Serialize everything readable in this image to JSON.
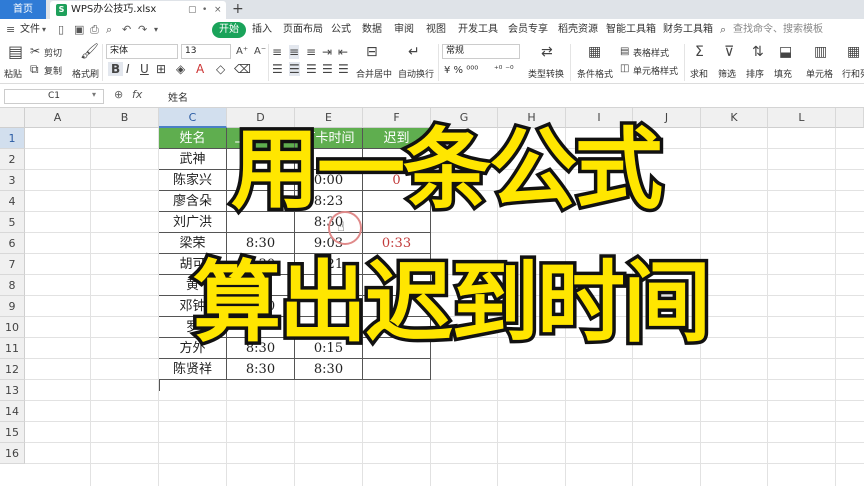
{
  "titlebar": {
    "home_tab": "首页",
    "file_name": "WPS办公技巧.xlsx",
    "file_icon": "S",
    "new_tab": "+",
    "tab_controls": [
      "▢",
      "•",
      "×"
    ]
  },
  "menubar": {
    "file_menu": "文件",
    "items": [
      "开始",
      "插入",
      "页面布局",
      "公式",
      "数据",
      "审阅",
      "视图",
      "开发工具",
      "会员专享",
      "稻壳资源",
      "智能工具箱",
      "财务工具箱"
    ],
    "search_placeholder": "查找命令、搜索模板"
  },
  "ribbon": {
    "paste": "粘贴",
    "cut": "剪切",
    "copy": "复制",
    "format_painter": "格式刷",
    "font_name": "宋体",
    "font_size": "13",
    "merge_center": "合并居中",
    "auto_wrap": "自动换行",
    "number_format": "常规",
    "type_convert": "类型转换",
    "conditional_format": "条件格式",
    "table_style": "表格样式",
    "cell_style": "单元格样式",
    "sum": "求和",
    "filter": "筛选",
    "sort": "排序",
    "fill": "填充",
    "cell": "单元格",
    "row_col": "行和列",
    "bold": "B",
    "italic": "I",
    "underline": "U",
    "percent_format": "¥ % ⁰⁰⁰",
    "decimal_format": "⁺⁰ ⁻⁰"
  },
  "formula_bar": {
    "cell_ref": "C1",
    "fx": "fx",
    "content": "姓名"
  },
  "grid": {
    "columns": [
      "A",
      "B",
      "C",
      "D",
      "E",
      "F",
      "G",
      "H",
      "I",
      "J",
      "K",
      "L"
    ],
    "selected_column": "C",
    "rows": [
      "1",
      "2",
      "3",
      "4",
      "5",
      "6",
      "7",
      "8",
      "9",
      "10",
      "11",
      "12",
      "13",
      "14",
      "15",
      "16"
    ],
    "selected_row": "1"
  },
  "table": {
    "headers": [
      "姓名",
      "上班时间",
      "打卡时间",
      "迟到"
    ],
    "rows": [
      [
        "武神",
        "",
        "",
        ""
      ],
      [
        "陈家兴",
        "",
        "0:00",
        "0"
      ],
      [
        "廖含朵",
        "",
        "8:23",
        ""
      ],
      [
        "刘广洪",
        "",
        "8:30",
        ""
      ],
      [
        "梁荣",
        "8:30",
        "9:03",
        "0:33"
      ],
      [
        "胡可",
        "8:30",
        "8:21",
        ""
      ],
      [
        "黄",
        "",
        "",
        ""
      ],
      [
        "邓钟",
        "8:30",
        "",
        ""
      ],
      [
        "罗",
        "",
        "",
        ""
      ],
      [
        "方外",
        "8:30",
        "0:15",
        ""
      ],
      [
        "陈贤祥",
        "8:30",
        "8:30",
        ""
      ]
    ]
  },
  "caption": {
    "line1": "用一条公式",
    "line2": "算出迟到时间"
  },
  "colors": {
    "header_green": "#5fae4f",
    "late_red": "#c23b3b",
    "caption_yellow": "#ffe600",
    "accent_blue": "#2f7bd6"
  }
}
